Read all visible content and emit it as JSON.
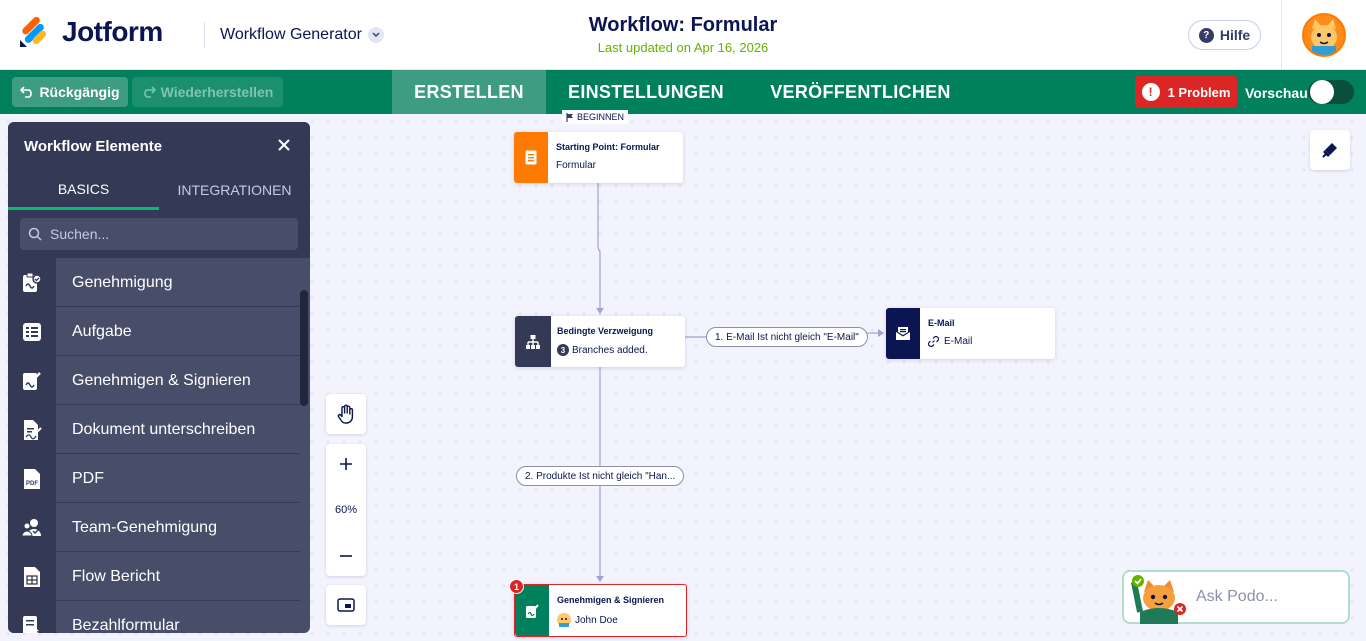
{
  "header": {
    "logo_text": "Jotform",
    "app_name": "Workflow Generator",
    "title": "Workflow: Formular",
    "subtitle": "Last updated on Apr 16, 2026",
    "help_label": "Hilfe"
  },
  "toolbar": {
    "undo_label": "Rückgängig",
    "redo_label": "Wiederherstellen",
    "tabs": [
      {
        "label": "ERSTELLEN",
        "active": true
      },
      {
        "label": "EINSTELLUNGEN",
        "active": false
      },
      {
        "label": "VERÖFFENTLICHEN",
        "active": false
      }
    ],
    "problem_label": "1 Problem",
    "problem_icon": "!",
    "preview_label": "Vorschau"
  },
  "panel": {
    "title": "Workflow Elemente",
    "tabs": [
      {
        "label": "BASICS",
        "active": true
      },
      {
        "label": "INTEGRATIONEN",
        "active": false
      }
    ],
    "search_placeholder": "Suchen...",
    "items": [
      {
        "label": "Genehmigung",
        "icon": "approval-icon"
      },
      {
        "label": "Aufgabe",
        "icon": "task-list-icon"
      },
      {
        "label": "Genehmigen & Signieren",
        "icon": "approve-sign-icon"
      },
      {
        "label": "Dokument unterschreiben",
        "icon": "sign-document-icon"
      },
      {
        "label": "PDF",
        "icon": "pdf-icon"
      },
      {
        "label": "Team-Genehmigung",
        "icon": "team-approval-icon"
      },
      {
        "label": "Flow Bericht",
        "icon": "flow-report-icon"
      },
      {
        "label": "Bezahlformular",
        "icon": "payment-form-icon"
      }
    ]
  },
  "zoom": {
    "level": "60%"
  },
  "canvas": {
    "begin_label": "BEGINNEN",
    "nodes": {
      "start": {
        "title": "Starting Point: Formular",
        "sub": "Formular"
      },
      "branch": {
        "title": "Bedingte Verzweigung",
        "count": "3",
        "sub": "Branches added."
      },
      "email": {
        "title": "E-Mail",
        "sub": "E-Mail"
      },
      "approve": {
        "title": "Genehmigen & Signieren",
        "sub": "John Doe",
        "error_count": "1"
      }
    },
    "edges": {
      "branch1": "1. E-Mail Ist nicht gleich \"E-Mail\"",
      "branch2": "2. Produkte Ist nicht gleich \"Han..."
    }
  },
  "assistant": {
    "label": "Ask Podo..."
  },
  "colors": {
    "brand_green": "#01805e",
    "active_tab": "#3d9c82",
    "start_orange": "#ff7a00",
    "branch_navy": "#343a55",
    "email_navy": "#0a1551",
    "approve_green": "#01805e",
    "error_red": "#dc2626"
  }
}
